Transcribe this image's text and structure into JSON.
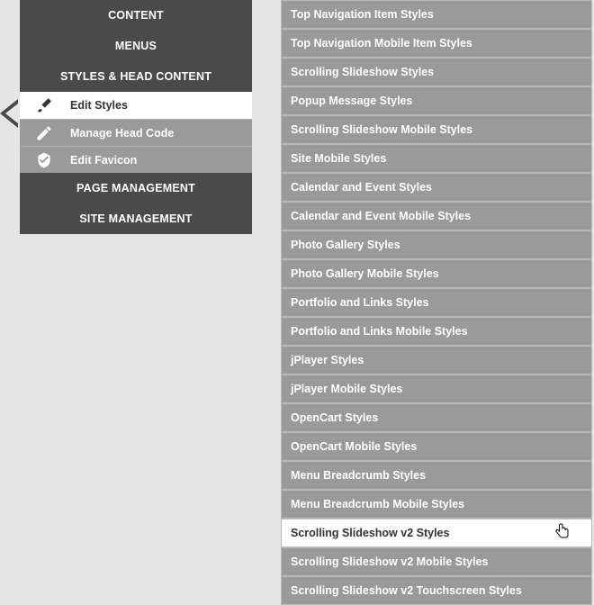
{
  "leftPanel": {
    "sections": {
      "content": "CONTENT",
      "menus": "MENUS",
      "stylesHead": "STYLES & HEAD CONTENT",
      "pageMgmt": "PAGE MANAGEMENT",
      "siteMgmt": "SITE MANAGEMENT"
    },
    "items": {
      "editStyles": "Edit Styles",
      "manageHead": "Manage Head Code",
      "editFavicon": "Edit Favicon"
    }
  },
  "styleList": [
    "Top Navigation Item Styles",
    "Top Navigation Mobile Item Styles",
    "Scrolling Slideshow Styles",
    "Popup Message Styles",
    "Scrolling Slideshow Mobile Styles",
    "Site Mobile Styles",
    "Calendar and Event Styles",
    "Calendar and Event Mobile Styles",
    "Photo Gallery Styles",
    "Photo Gallery Mobile Styles",
    "Portfolio and Links Styles",
    "Portfolio and Links Mobile Styles",
    "jPlayer Styles",
    "jPlayer Mobile Styles",
    "OpenCart Styles",
    "OpenCart Mobile Styles",
    "Menu Breadcrumb Styles",
    "Menu Breadcrumb Mobile Styles",
    "Scrolling Slideshow v2 Styles",
    "Scrolling Slideshow v2 Mobile Styles",
    "Scrolling Slideshow v2 Touchscreen Styles"
  ],
  "hoveredIndex": 18
}
